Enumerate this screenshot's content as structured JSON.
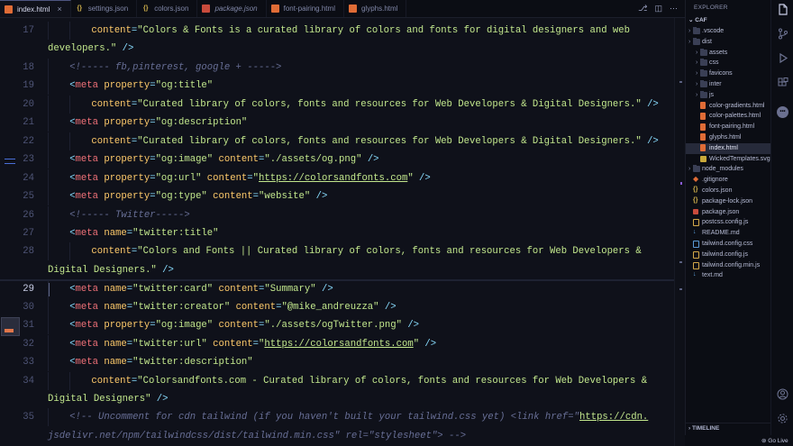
{
  "tabs": [
    {
      "label": "index.html",
      "type": "html",
      "active": true,
      "italic": false
    },
    {
      "label": "settings.json",
      "type": "json",
      "active": false,
      "italic": false
    },
    {
      "label": "colors.json",
      "type": "json",
      "active": false,
      "italic": false
    },
    {
      "label": "package.json",
      "type": "pkg",
      "active": false,
      "italic": true
    },
    {
      "label": "font-pairing.html",
      "type": "html",
      "active": false,
      "italic": false
    },
    {
      "label": "glyphs.html",
      "type": "html",
      "active": false,
      "italic": false
    }
  ],
  "tab_actions": [
    "source-control-icon",
    "split-editor-icon",
    "more-actions-icon"
  ],
  "current_line": 29,
  "editor_lines": [
    {
      "n": "17",
      "indent": 2,
      "tokens": [
        [
          "attr",
          "content"
        ],
        [
          "eq",
          "="
        ],
        [
          "str",
          "\"Colors & Fonts is a curated library of colors and fonts for digital designers and web"
        ]
      ]
    },
    {
      "n": "",
      "indent": 0,
      "tokens": [
        [
          "str",
          "developers.\""
        ],
        [
          "plain",
          " "
        ],
        [
          "br",
          "/>"
        ]
      ]
    },
    {
      "n": "18",
      "indent": 1,
      "tokens": [
        [
          "com",
          "<!----- fb,pinterest, google + ----->"
        ]
      ]
    },
    {
      "n": "19",
      "indent": 1,
      "tokens": [
        [
          "br",
          "<"
        ],
        [
          "tag",
          "meta"
        ],
        [
          "plain",
          " "
        ],
        [
          "attr",
          "property"
        ],
        [
          "eq",
          "="
        ],
        [
          "str",
          "\"og:title\""
        ]
      ]
    },
    {
      "n": "20",
      "indent": 2,
      "tokens": [
        [
          "attr",
          "content"
        ],
        [
          "eq",
          "="
        ],
        [
          "str",
          "\"Curated library of colors, fonts and resources for Web Developers & Digital Designers.\""
        ],
        [
          "plain",
          " "
        ],
        [
          "br",
          "/>"
        ]
      ]
    },
    {
      "n": "21",
      "indent": 1,
      "tokens": [
        [
          "br",
          "<"
        ],
        [
          "tag",
          "meta"
        ],
        [
          "plain",
          " "
        ],
        [
          "attr",
          "property"
        ],
        [
          "eq",
          "="
        ],
        [
          "str",
          "\"og:description\""
        ]
      ]
    },
    {
      "n": "22",
      "indent": 2,
      "tokens": [
        [
          "attr",
          "content"
        ],
        [
          "eq",
          "="
        ],
        [
          "str",
          "\"Curated library of colors, fonts and resources for Web Developers & Digital Designers.\""
        ],
        [
          "plain",
          " "
        ],
        [
          "br",
          "/>"
        ]
      ]
    },
    {
      "n": "23",
      "indent": 1,
      "tokens": [
        [
          "br",
          "<"
        ],
        [
          "tag",
          "meta"
        ],
        [
          "plain",
          " "
        ],
        [
          "attr",
          "property"
        ],
        [
          "eq",
          "="
        ],
        [
          "str",
          "\"og:image\""
        ],
        [
          "plain",
          " "
        ],
        [
          "attr",
          "content"
        ],
        [
          "eq",
          "="
        ],
        [
          "str",
          "\"./assets/og.png\""
        ],
        [
          "plain",
          " "
        ],
        [
          "br",
          "/>"
        ]
      ]
    },
    {
      "n": "24",
      "indent": 1,
      "tokens": [
        [
          "br",
          "<"
        ],
        [
          "tag",
          "meta"
        ],
        [
          "plain",
          " "
        ],
        [
          "attr",
          "property"
        ],
        [
          "eq",
          "="
        ],
        [
          "str",
          "\"og:url\""
        ],
        [
          "plain",
          " "
        ],
        [
          "attr",
          "content"
        ],
        [
          "eq",
          "="
        ],
        [
          "str",
          "\""
        ],
        [
          "url",
          "https://colorsandfonts.com"
        ],
        [
          "str",
          "\""
        ],
        [
          "plain",
          " "
        ],
        [
          "br",
          "/>"
        ]
      ]
    },
    {
      "n": "25",
      "indent": 1,
      "tokens": [
        [
          "br",
          "<"
        ],
        [
          "tag",
          "meta"
        ],
        [
          "plain",
          " "
        ],
        [
          "attr",
          "property"
        ],
        [
          "eq",
          "="
        ],
        [
          "str",
          "\"og:type\""
        ],
        [
          "plain",
          " "
        ],
        [
          "attr",
          "content"
        ],
        [
          "eq",
          "="
        ],
        [
          "str",
          "\"website\""
        ],
        [
          "plain",
          " "
        ],
        [
          "br",
          "/>"
        ]
      ]
    },
    {
      "n": "26",
      "indent": 1,
      "tokens": [
        [
          "com",
          "<!----- Twitter----->"
        ]
      ]
    },
    {
      "n": "27",
      "indent": 1,
      "tokens": [
        [
          "br",
          "<"
        ],
        [
          "tag",
          "meta"
        ],
        [
          "plain",
          " "
        ],
        [
          "attr",
          "name"
        ],
        [
          "eq",
          "="
        ],
        [
          "str",
          "\"twitter:title\""
        ]
      ]
    },
    {
      "n": "28",
      "indent": 2,
      "tokens": [
        [
          "attr",
          "content"
        ],
        [
          "eq",
          "="
        ],
        [
          "str",
          "\"Colors and Fonts || Curated library of colors, fonts and resources for Web Developers &"
        ]
      ]
    },
    {
      "n": "",
      "indent": 0,
      "tokens": [
        [
          "str",
          "Digital Designers.\""
        ],
        [
          "plain",
          " "
        ],
        [
          "br",
          "/>"
        ]
      ]
    },
    {
      "n": "29",
      "indent": 1,
      "tokens": [
        [
          "br",
          "<"
        ],
        [
          "tag",
          "meta"
        ],
        [
          "plain",
          " "
        ],
        [
          "attr",
          "name"
        ],
        [
          "eq",
          "="
        ],
        [
          "str",
          "\"twitter:card\""
        ],
        [
          "plain",
          " "
        ],
        [
          "attr",
          "content"
        ],
        [
          "eq",
          "="
        ],
        [
          "str",
          "\"Summary\""
        ],
        [
          "plain",
          " "
        ],
        [
          "br",
          "/>"
        ]
      ]
    },
    {
      "n": "30",
      "indent": 1,
      "tokens": [
        [
          "br",
          "<"
        ],
        [
          "tag",
          "meta"
        ],
        [
          "plain",
          " "
        ],
        [
          "attr",
          "name"
        ],
        [
          "eq",
          "="
        ],
        [
          "str",
          "\"twitter:creator\""
        ],
        [
          "plain",
          " "
        ],
        [
          "attr",
          "content"
        ],
        [
          "eq",
          "="
        ],
        [
          "str",
          "\"@mike_andreuzza\""
        ],
        [
          "plain",
          " "
        ],
        [
          "br",
          "/>"
        ]
      ]
    },
    {
      "n": "31",
      "indent": 1,
      "tokens": [
        [
          "br",
          "<"
        ],
        [
          "tag",
          "meta"
        ],
        [
          "plain",
          " "
        ],
        [
          "attr",
          "property"
        ],
        [
          "eq",
          "="
        ],
        [
          "str",
          "\"og:image\""
        ],
        [
          "plain",
          " "
        ],
        [
          "attr",
          "content"
        ],
        [
          "eq",
          "="
        ],
        [
          "str",
          "\"./assets/ogTwitter.png\""
        ],
        [
          "plain",
          " "
        ],
        [
          "br",
          "/>"
        ]
      ]
    },
    {
      "n": "32",
      "indent": 1,
      "tokens": [
        [
          "br",
          "<"
        ],
        [
          "tag",
          "meta"
        ],
        [
          "plain",
          " "
        ],
        [
          "attr",
          "name"
        ],
        [
          "eq",
          "="
        ],
        [
          "str",
          "\"twitter:url\""
        ],
        [
          "plain",
          " "
        ],
        [
          "attr",
          "content"
        ],
        [
          "eq",
          "="
        ],
        [
          "str",
          "\""
        ],
        [
          "url",
          "https://colorsandfonts.com"
        ],
        [
          "str",
          "\""
        ],
        [
          "plain",
          " "
        ],
        [
          "br",
          "/>"
        ]
      ]
    },
    {
      "n": "33",
      "indent": 1,
      "tokens": [
        [
          "br",
          "<"
        ],
        [
          "tag",
          "meta"
        ],
        [
          "plain",
          " "
        ],
        [
          "attr",
          "name"
        ],
        [
          "eq",
          "="
        ],
        [
          "str",
          "\"twitter:description\""
        ]
      ]
    },
    {
      "n": "34",
      "indent": 2,
      "tokens": [
        [
          "attr",
          "content"
        ],
        [
          "eq",
          "="
        ],
        [
          "str",
          "\"Colorsandfonts.com - Curated library of colors, fonts and resources for Web Developers &"
        ]
      ]
    },
    {
      "n": "",
      "indent": 0,
      "tokens": [
        [
          "str",
          "Digital Designers\""
        ],
        [
          "plain",
          " "
        ],
        [
          "br",
          "/>"
        ]
      ]
    },
    {
      "n": "35",
      "indent": 1,
      "tokens": [
        [
          "com",
          "<!-- Uncomment for cdn tailwind (if you haven't built your tailwind.css yet) <link href=\""
        ],
        [
          "url",
          "https://cdn."
        ]
      ]
    },
    {
      "n": "",
      "indent": 0,
      "tokens": [
        [
          "com",
          "jsdelivr.net/npm/tailwindcss/dist/tailwind.min.css\" rel=\"stylesheet\"> -->"
        ]
      ]
    }
  ],
  "explorer": {
    "title": "EXPLORER",
    "root": "CAF",
    "items": [
      {
        "label": ".vscode",
        "type": "folder",
        "depth": 0
      },
      {
        "label": "dist",
        "type": "folder",
        "depth": 0
      },
      {
        "label": "assets",
        "type": "folder",
        "depth": 1
      },
      {
        "label": "css",
        "type": "folder",
        "depth": 1
      },
      {
        "label": "favicons",
        "type": "folder",
        "depth": 1
      },
      {
        "label": "inter",
        "type": "folder",
        "depth": 1
      },
      {
        "label": "js",
        "type": "folder",
        "depth": 1
      },
      {
        "label": "color-gradients.html",
        "type": "html",
        "depth": 1
      },
      {
        "label": "color-palettes.html",
        "type": "html",
        "depth": 1
      },
      {
        "label": "font-pairing.html",
        "type": "html",
        "depth": 1
      },
      {
        "label": "glyphs.html",
        "type": "html",
        "depth": 1
      },
      {
        "label": "index.html",
        "type": "html",
        "depth": 1,
        "selected": true
      },
      {
        "label": "WickedTemplates.svg",
        "type": "svg",
        "depth": 1
      },
      {
        "label": "node_modules",
        "type": "folder",
        "depth": 0
      },
      {
        "label": ".gitignore",
        "type": "git",
        "depth": 0
      },
      {
        "label": "colors.json",
        "type": "json",
        "depth": 0
      },
      {
        "label": "package-lock.json",
        "type": "json",
        "depth": 0
      },
      {
        "label": "package.json",
        "type": "pkg",
        "depth": 0
      },
      {
        "label": "postcss.config.js",
        "type": "js",
        "depth": 0
      },
      {
        "label": "README.md",
        "type": "md",
        "depth": 0
      },
      {
        "label": "tailwind.config.css",
        "type": "css",
        "depth": 0
      },
      {
        "label": "tailwind.config.js",
        "type": "js",
        "depth": 0
      },
      {
        "label": "tailwind.config.min.js",
        "type": "js",
        "depth": 0
      },
      {
        "label": "text.md",
        "type": "md",
        "depth": 0
      }
    ],
    "timeline": "TIMELINE"
  },
  "activity_bar": [
    "files-icon",
    "source-control-icon",
    "run-debug-icon",
    "extensions-icon",
    "remote-icon",
    "account-icon",
    "settings-gear-icon"
  ],
  "status_bar": {
    "golive": "Go Live"
  },
  "colors": {
    "background": "#0f111a",
    "tag": "#f07178",
    "attribute": "#ffcb6b",
    "string": "#c3e88d",
    "comment": "#676e95",
    "punctuation": "#89ddff"
  }
}
